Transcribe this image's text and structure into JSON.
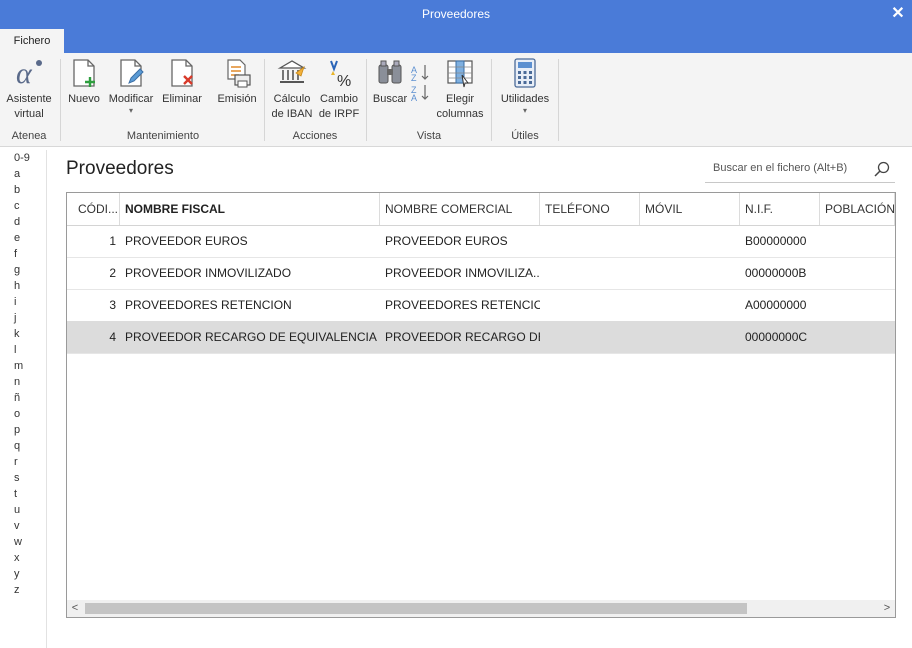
{
  "window": {
    "title": "Proveedores",
    "close_glyph": "✕"
  },
  "ribbon": {
    "tab": "Fichero",
    "buttons": {
      "asistente": {
        "line1": "Asistente",
        "line2": "virtual",
        "icon": "atenea-alpha-icon"
      },
      "nuevo": {
        "label": "Nuevo",
        "icon": "new-document-icon"
      },
      "modificar": {
        "label": "Modificar",
        "icon": "edit-document-icon"
      },
      "eliminar": {
        "label": "Eliminar",
        "icon": "delete-document-icon"
      },
      "emision": {
        "label": "Emisión",
        "icon": "print-icon"
      },
      "calculo_iban": {
        "line1": "Cálculo",
        "line2": "de IBAN",
        "icon": "bank-icon"
      },
      "cambio_irpf": {
        "line1": "Cambio",
        "line2": "de IRPF",
        "icon": "percent-icon"
      },
      "buscar": {
        "label": "Buscar",
        "icon": "binoculars-icon"
      },
      "ordenar": {
        "icon": "sort-az-icon"
      },
      "elegir": {
        "line1": "Elegir",
        "line2": "columnas",
        "icon": "columns-icon"
      },
      "utilidades": {
        "label": "Utilidades",
        "icon": "calculator-icon"
      }
    },
    "groups": {
      "atenea": "Atenea",
      "mantenimiento": "Mantenimiento",
      "acciones": "Acciones",
      "vista": "Vista",
      "utiles": "Útiles"
    }
  },
  "alphabet": [
    "0-9",
    "a",
    "b",
    "c",
    "d",
    "e",
    "f",
    "g",
    "h",
    "i",
    "j",
    "k",
    "l",
    "m",
    "n",
    "ñ",
    "o",
    "p",
    "q",
    "r",
    "s",
    "t",
    "u",
    "v",
    "w",
    "x",
    "y",
    "z"
  ],
  "main": {
    "title": "Proveedores",
    "search_placeholder": "Buscar en el fichero (Alt+B)"
  },
  "table": {
    "columns": [
      "CÓDI...",
      "NOMBRE FISCAL",
      "NOMBRE COMERCIAL",
      "TELÉFONO",
      "MÓVIL",
      "N.I.F.",
      "POBLACIÓN"
    ],
    "rows": [
      {
        "codigo": "1",
        "nombre_fiscal": "PROVEEDOR EUROS",
        "nombre_comercial": "PROVEEDOR EUROS",
        "telefono": "",
        "movil": "",
        "nif": "B00000000",
        "poblacion": ""
      },
      {
        "codigo": "2",
        "nombre_fiscal": "PROVEEDOR INMOVILIZADO",
        "nombre_comercial": "PROVEEDOR INMOVILIZA...",
        "telefono": "",
        "movil": "",
        "nif": "00000000B",
        "poblacion": ""
      },
      {
        "codigo": "3",
        "nombre_fiscal": "PROVEEDORES RETENCION",
        "nombre_comercial": "PROVEEDORES RETENCION",
        "telefono": "",
        "movil": "",
        "nif": "A00000000",
        "poblacion": ""
      },
      {
        "codigo": "4",
        "nombre_fiscal": "PROVEEDOR RECARGO DE EQUIVALENCIA",
        "nombre_comercial": "PROVEEDOR RECARGO DE ...",
        "telefono": "",
        "movil": "",
        "nif": "00000000C",
        "poblacion": ""
      }
    ],
    "selected_row": 4
  },
  "colors": {
    "titlebar": "#4a7bd8",
    "ribbon": "#f4f4f4",
    "selected_row": "#dcdcdc",
    "accent_green": "#2e9e3e",
    "accent_red": "#d83a2a"
  }
}
